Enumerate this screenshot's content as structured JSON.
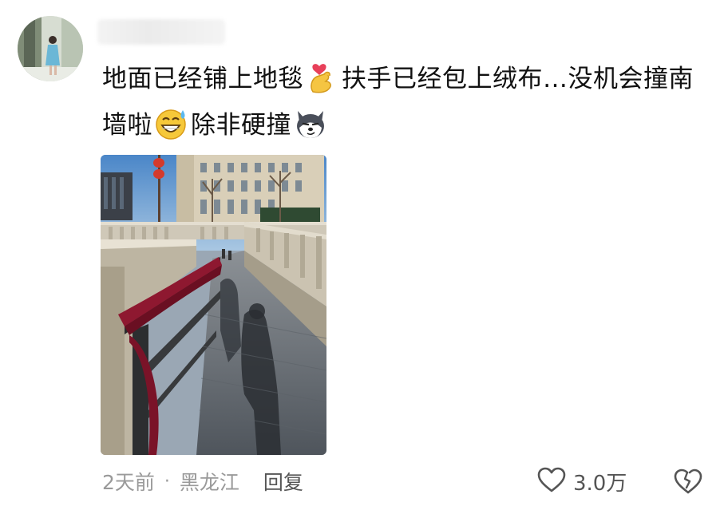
{
  "comment": {
    "author_avatar_icon": "user-avatar-photo",
    "text_part1": "地面已经铺上地毯",
    "emoji1": "finger-heart-emoji",
    "text_part2": "扶手已经包上绒布…没机会撞南墙啦",
    "emoji2": "grinning-sweat-emoji",
    "text_part3": "除非硬撞",
    "emoji3": "husky-dog-emoji",
    "image_icon": "photo-underpass-ramp-red-velvet-handrail"
  },
  "footer": {
    "time": "2天前",
    "separator": "·",
    "location": "黑龙江",
    "reply_label": "回复",
    "like_count": "3.0万",
    "like_icon": "heart-outline-icon",
    "dislike_icon": "broken-heart-outline-icon"
  },
  "colors": {
    "text": "#111111",
    "meta": "#9a9a9a",
    "action": "#555555"
  }
}
